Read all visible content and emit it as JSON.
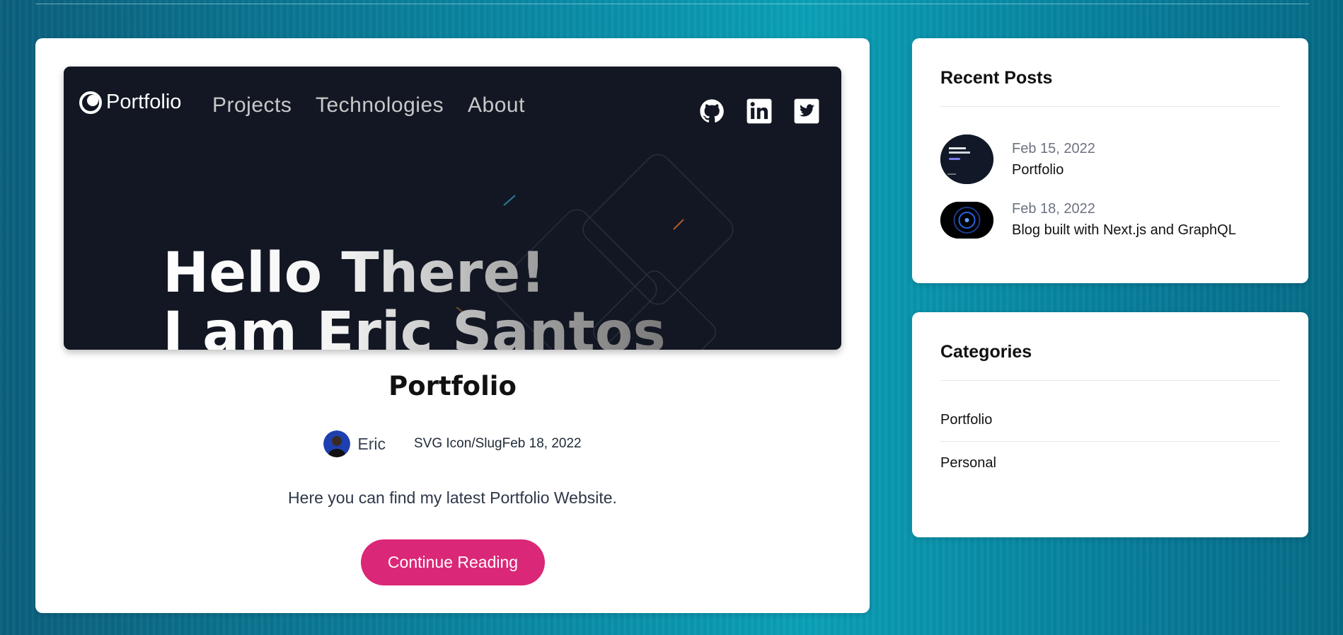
{
  "hero": {
    "logo": "Portfolio",
    "nav": [
      "Projects",
      "Technologies",
      "About"
    ],
    "social_icons": [
      "github-icon",
      "linkedin-icon",
      "twitter-icon"
    ],
    "headline_line1": "Hello There!",
    "headline_line2": "I am Eric Santos"
  },
  "post": {
    "title": "Portfolio",
    "author": "Eric",
    "meta": "SVG Icon/SlugFeb 18, 2022",
    "excerpt": "Here you can find my latest Portfolio Website.",
    "cta": "Continue Reading"
  },
  "recent": {
    "title": "Recent Posts",
    "items": [
      {
        "date": "Feb 15, 2022",
        "name": "Portfolio"
      },
      {
        "date": "Feb 18, 2022",
        "name": "Blog built with Next.js and GraphQL"
      }
    ]
  },
  "categories": {
    "title": "Categories",
    "items": [
      "Portfolio",
      "Personal"
    ]
  },
  "colors": {
    "accent": "#db2777",
    "hero_bg": "#121723"
  }
}
